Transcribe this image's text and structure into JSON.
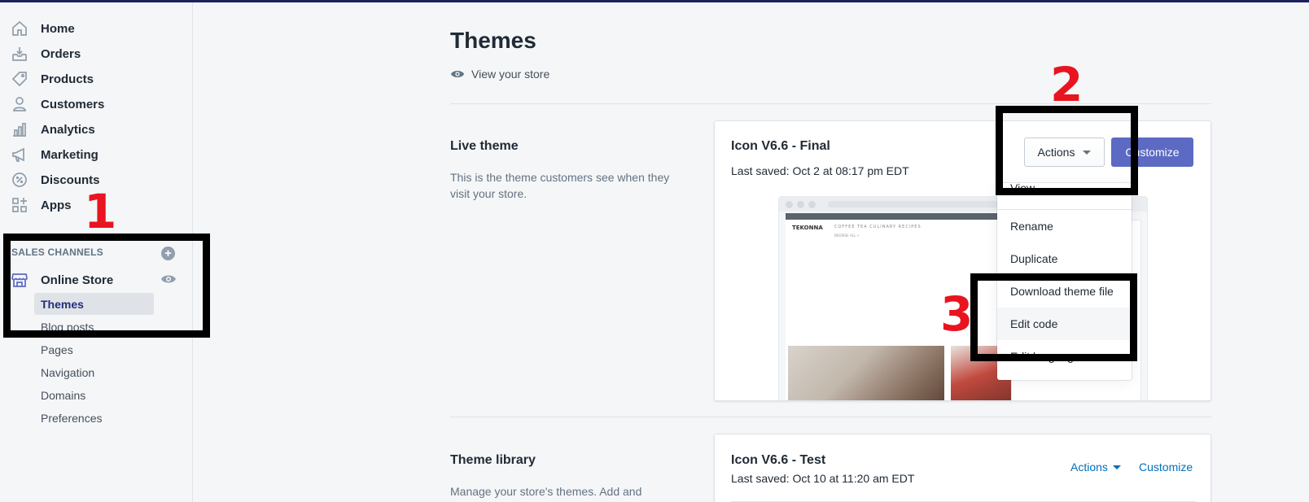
{
  "sidebar": {
    "nav": [
      {
        "label": "Home",
        "icon": "home-icon"
      },
      {
        "label": "Orders",
        "icon": "orders-icon"
      },
      {
        "label": "Products",
        "icon": "tag-icon"
      },
      {
        "label": "Customers",
        "icon": "person-icon"
      },
      {
        "label": "Analytics",
        "icon": "bar-chart-icon"
      },
      {
        "label": "Marketing",
        "icon": "megaphone-icon"
      },
      {
        "label": "Discounts",
        "icon": "discount-icon"
      },
      {
        "label": "Apps",
        "icon": "apps-icon"
      }
    ],
    "sales_channels_label": "SALES CHANNELS",
    "online_store_label": "Online Store",
    "sub_items": [
      "Themes",
      "Blog posts",
      "Pages",
      "Navigation",
      "Domains",
      "Preferences"
    ]
  },
  "main": {
    "title": "Themes",
    "view_store": "View your store",
    "live_theme": {
      "heading": "Live theme",
      "description": "This is the theme customers see when they visit your store.",
      "name": "Icon V6.6 - Final",
      "saved": "Last saved: Oct 2 at 08:17 pm EDT",
      "actions_label": "Actions",
      "customize_label": "Customize",
      "preview": {
        "logo": "TEKONNA",
        "menu": "COFFEE  TEA  CULINARY  RECIPES",
        "sub": "BROWSE ALL >"
      }
    },
    "dropdown": [
      "View",
      "Rename",
      "Duplicate",
      "Download theme file",
      "Edit code",
      "Edit languages"
    ],
    "library": {
      "heading": "Theme library",
      "description": "Manage your store's themes. Add and",
      "name": "Icon V6.6 - Test",
      "saved": "Last saved: Oct 10 at 11:20 am EDT",
      "actions_label": "Actions",
      "customize_label": "Customize"
    }
  },
  "annotations": {
    "step1": "1",
    "step2": "2",
    "step3": "3"
  },
  "colors": {
    "accent": "#5c6ac4",
    "link": "#006fbb",
    "annotation": "#e8141f",
    "topbar": "#1c2260"
  }
}
